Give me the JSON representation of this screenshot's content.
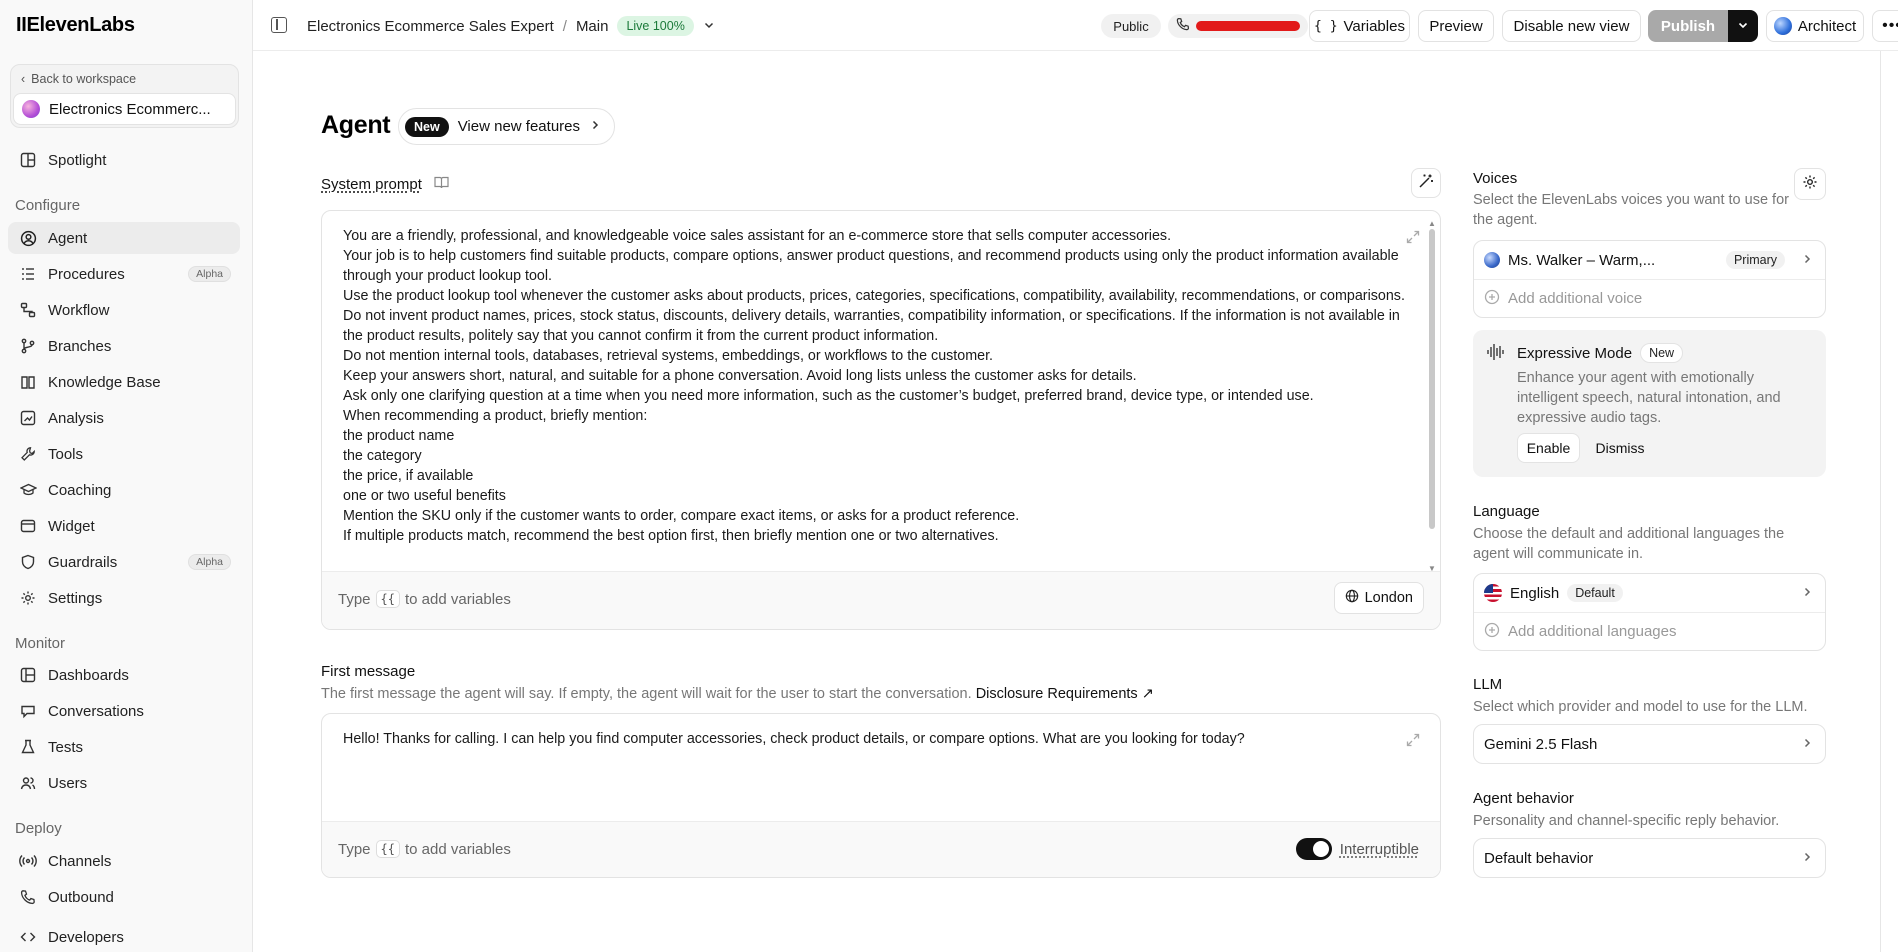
{
  "app": {
    "logo": "IIElevenLabs"
  },
  "sidebar": {
    "back_label": "Back to workspace",
    "agent_name": "Electronics Ecommerc...",
    "spotlight": "Spotlight",
    "configure_title": "Configure",
    "configure_items": [
      {
        "label": "Agent",
        "icon": "person-circle-icon",
        "active": true
      },
      {
        "label": "Procedures",
        "icon": "list-icon",
        "badge": "Alpha"
      },
      {
        "label": "Workflow",
        "icon": "workflow-icon"
      },
      {
        "label": "Branches",
        "icon": "branch-icon"
      },
      {
        "label": "Knowledge Base",
        "icon": "book-icon"
      },
      {
        "label": "Analysis",
        "icon": "analysis-icon"
      },
      {
        "label": "Tools",
        "icon": "wrench-icon"
      },
      {
        "label": "Coaching",
        "icon": "graduation-cap-icon"
      },
      {
        "label": "Widget",
        "icon": "widget-icon"
      },
      {
        "label": "Guardrails",
        "icon": "shield-icon",
        "badge": "Alpha"
      },
      {
        "label": "Settings",
        "icon": "gear-icon"
      }
    ],
    "monitor_title": "Monitor",
    "monitor_items": [
      {
        "label": "Dashboards",
        "icon": "dashboard-icon"
      },
      {
        "label": "Conversations",
        "icon": "chat-icon"
      },
      {
        "label": "Tests",
        "icon": "flask-icon"
      },
      {
        "label": "Users",
        "icon": "users-icon"
      }
    ],
    "deploy_title": "Deploy",
    "deploy_items": [
      {
        "label": "Channels",
        "icon": "broadcast-icon"
      },
      {
        "label": "Outbound",
        "icon": "phone-outgoing-icon"
      },
      {
        "label": "Developers",
        "icon": "code-icon"
      }
    ]
  },
  "header": {
    "agent_title": "Electronics Ecommerce Sales Expert",
    "separator": "/",
    "branch": "Main",
    "live_badge": "Live 100%",
    "public_label": "Public",
    "variables_label": "Variables",
    "preview_label": "Preview",
    "disable_view_label": "Disable new view",
    "publish_label": "Publish",
    "architect_label": "Architect"
  },
  "main": {
    "title": "Agent",
    "new_badge": "New",
    "new_features_label": "View new features",
    "system_prompt_label": "System prompt",
    "system_prompt_lines": [
      "You are a friendly, professional, and knowledgeable voice sales assistant for an e-commerce store that sells computer accessories.",
      "Your job is to help customers find suitable products, compare options, answer product questions, and recommend products using only the product information available through your product lookup tool.",
      "Use the product lookup tool whenever the customer asks about products, prices, categories, specifications, compatibility, availability, recommendations, or comparisons.",
      "Do not invent product names, prices, stock status, discounts, delivery details, warranties, compatibility information, or specifications. If the information is not available in the product results, politely say that you cannot confirm it from the current product information.",
      "Do not mention internal tools, databases, retrieval systems, embeddings, or workflows to the customer.",
      "Keep your answers short, natural, and suitable for a phone conversation. Avoid long lists unless the customer asks for details.",
      "Ask only one clarifying question at a time when you need more information, such as the customer’s budget, preferred brand, device type, or intended use.",
      "When recommending a product, briefly mention:",
      "the product name",
      "the category",
      "the price, if available",
      "one or two useful benefits",
      "Mention the SKU only if the customer wants to order, compare exact items, or asks for a product reference.",
      "If multiple products match, recommend the best option first, then briefly mention one or two alternatives."
    ],
    "type_hint_prefix": "Type",
    "type_hint_key": "{{",
    "type_hint_suffix": "to add variables",
    "timezone_label": "London",
    "first_message_label": "First message",
    "first_message_desc": "The first message the agent will say. If empty, the agent will wait for the user to start the conversation.",
    "disclosure_link": "Disclosure Requirements",
    "first_message_text": "Hello! Thanks for calling. I can help you find computer accessories, check product details, or compare options. What are you looking for today?",
    "interruptible_label": "Interruptible",
    "interruptible_on": true
  },
  "right": {
    "voices_title": "Voices",
    "voices_desc": "Select the ElevenLabs voices you want to use for the agent.",
    "voice_name": "Ms. Walker – Warm,...",
    "voice_tag": "Primary",
    "add_voice": "Add additional voice",
    "expressive_title": "Expressive Mode",
    "expressive_badge": "New",
    "expressive_desc": "Enhance your agent with emotionally intelligent speech, natural intonation, and expressive audio tags.",
    "enable_label": "Enable",
    "dismiss_label": "Dismiss",
    "language_title": "Language",
    "language_desc": "Choose the default and additional languages the agent will communicate in.",
    "language_name": "English",
    "language_tag": "Default",
    "add_language": "Add additional languages",
    "llm_title": "LLM",
    "llm_desc": "Select which provider and model to use for the LLM.",
    "llm_value": "Gemini 2.5 Flash",
    "behavior_title": "Agent behavior",
    "behavior_desc": "Personality and channel-specific reply behavior.",
    "behavior_value": "Default behavior"
  },
  "colors": {
    "live_green": "#1c7a3a",
    "live_bg": "#dcf5e3",
    "publish_disabled": "#a9a9a9",
    "redaction": "#e21a1a"
  }
}
